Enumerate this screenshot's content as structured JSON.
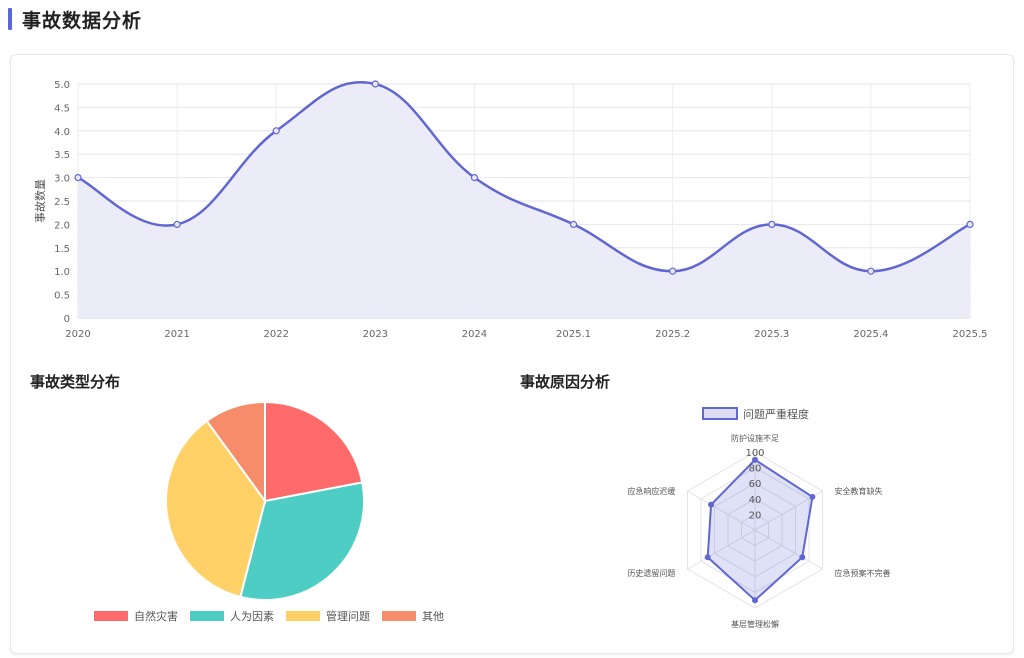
{
  "page": {
    "title": "事故数据分析",
    "accent": "#5b67d6"
  },
  "line_chart": {
    "ylabel": "事故数量",
    "line_color": "#6167d1",
    "fill_color": "#eaeaf8"
  },
  "pie_section": {
    "title": "事故类型分布"
  },
  "radar_section": {
    "title": "事故原因分析"
  },
  "chart_data": [
    {
      "type": "line",
      "categories": [
        "2020",
        "2021",
        "2022",
        "2023",
        "2024",
        "2025.1",
        "2025.2",
        "2025.3",
        "2025.4",
        "2025.5"
      ],
      "values": [
        3,
        2,
        4,
        5,
        3,
        2,
        1,
        2,
        1,
        2
      ],
      "xlabel": "",
      "ylabel": "事故数量",
      "ylim": [
        0,
        5
      ],
      "yticks": [
        "0",
        "0.5",
        "1.0",
        "1.5",
        "2.0",
        "2.5",
        "3.0",
        "3.5",
        "4.0",
        "4.5",
        "5.0"
      ],
      "grid": true,
      "fill": true
    },
    {
      "type": "pie",
      "labels": [
        "自然灾害",
        "人为因素",
        "管理问题",
        "其他"
      ],
      "values": [
        22,
        32,
        36,
        10
      ],
      "colors": [
        "#ff6b6b",
        "#4ecdc4",
        "#ffd166",
        "#f78c6b"
      ],
      "legend": "bottom"
    },
    {
      "type": "radar",
      "axes": [
        "防护设施不足",
        "安全教育缺失",
        "应急预案不完善",
        "基层管理松懈",
        "历史遗留问题",
        "应急响应迟缓"
      ],
      "series": [
        {
          "name": "问题严重程度",
          "values": [
            90,
            85,
            70,
            90,
            70,
            65
          ]
        }
      ],
      "rlim": [
        0,
        100
      ],
      "rticks": [
        "20",
        "40",
        "60",
        "80",
        "100"
      ],
      "legend": "top"
    }
  ]
}
